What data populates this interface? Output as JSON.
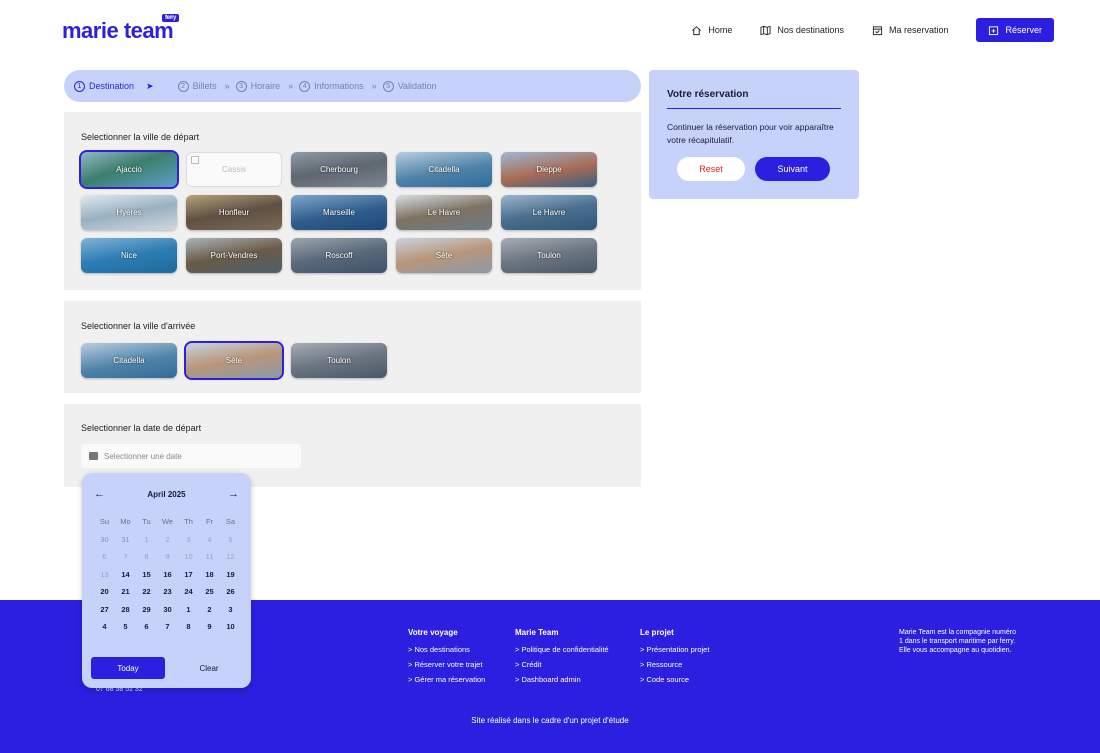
{
  "header": {
    "logo": "marie team",
    "logo_badge": "ferry",
    "nav": [
      {
        "label": "Home",
        "icon": "home-icon"
      },
      {
        "label": "Nos destinations",
        "icon": "map-icon"
      },
      {
        "label": "Ma reservation",
        "icon": "calendar-check-icon"
      }
    ],
    "cta": {
      "label": "Réserver",
      "icon": "calendar-plus-icon"
    }
  },
  "stepper": {
    "steps": [
      {
        "num": "1",
        "label": "Destination",
        "active": true
      },
      {
        "num": "2",
        "label": "Billets"
      },
      {
        "num": "3",
        "label": "Horaire"
      },
      {
        "num": "4",
        "label": "Informations"
      },
      {
        "num": "5",
        "label": "Validation"
      }
    ],
    "separator": "»"
  },
  "departure": {
    "title": "Selectionner la ville de départ",
    "cities": [
      {
        "name": "Ajaccio",
        "selected": true
      },
      {
        "name": "Cassis",
        "broken": true
      },
      {
        "name": "Cherbourg"
      },
      {
        "name": "Citadella"
      },
      {
        "name": "Dieppe"
      },
      {
        "name": "Hyères"
      },
      {
        "name": "Honfleur"
      },
      {
        "name": "Marseille"
      },
      {
        "name": "Le Havre"
      },
      {
        "name": "Le Havre"
      },
      {
        "name": "Nice"
      },
      {
        "name": "Port-Vendres"
      },
      {
        "name": "Roscoff"
      },
      {
        "name": "Sète"
      },
      {
        "name": "Toulon"
      }
    ]
  },
  "arrival": {
    "title": "Selectionner la ville d'arrivée",
    "cities": [
      {
        "name": "Citadella"
      },
      {
        "name": "Sète",
        "selected": true
      },
      {
        "name": "Toulon"
      }
    ]
  },
  "date": {
    "title": "Selectionner la date de départ",
    "placeholder": "Selectionner une date"
  },
  "summary": {
    "title": "Votre réservation",
    "text": "Continuer la réservation pour voir apparaître votre récapitulatif.",
    "reset": "Reset",
    "next": "Suivant"
  },
  "calendar": {
    "month": "April 2025",
    "prev": "←",
    "next": "→",
    "weekdays": [
      "Su",
      "Mo",
      "Tu",
      "We",
      "Th",
      "Fr",
      "Sa"
    ],
    "days": [
      {
        "d": "30",
        "s": "mut"
      },
      {
        "d": "31",
        "s": "mut"
      },
      {
        "d": "1",
        "s": "dim"
      },
      {
        "d": "2",
        "s": "dim"
      },
      {
        "d": "3",
        "s": "dim"
      },
      {
        "d": "4",
        "s": "dim"
      },
      {
        "d": "5",
        "s": "dim"
      },
      {
        "d": "6",
        "s": "dim"
      },
      {
        "d": "7",
        "s": "dim"
      },
      {
        "d": "8",
        "s": "dim"
      },
      {
        "d": "9",
        "s": "dim"
      },
      {
        "d": "10",
        "s": "dim"
      },
      {
        "d": "11",
        "s": "dim"
      },
      {
        "d": "12",
        "s": "dim"
      },
      {
        "d": "13",
        "s": "dim"
      },
      {
        "d": "14",
        "s": "on"
      },
      {
        "d": "15",
        "s": "on"
      },
      {
        "d": "16",
        "s": "on"
      },
      {
        "d": "17",
        "s": "on"
      },
      {
        "d": "18",
        "s": "on"
      },
      {
        "d": "19",
        "s": "on"
      },
      {
        "d": "20",
        "s": "on"
      },
      {
        "d": "21",
        "s": "on"
      },
      {
        "d": "22",
        "s": "on"
      },
      {
        "d": "23",
        "s": "on"
      },
      {
        "d": "24",
        "s": "on"
      },
      {
        "d": "25",
        "s": "on"
      },
      {
        "d": "26",
        "s": "on"
      },
      {
        "d": "27",
        "s": "on"
      },
      {
        "d": "28",
        "s": "on"
      },
      {
        "d": "29",
        "s": "on"
      },
      {
        "d": "30",
        "s": "on"
      },
      {
        "d": "1",
        "s": "on"
      },
      {
        "d": "2",
        "s": "on"
      },
      {
        "d": "3",
        "s": "on"
      },
      {
        "d": "4",
        "s": "on"
      },
      {
        "d": "5",
        "s": "on"
      },
      {
        "d": "6",
        "s": "on"
      },
      {
        "d": "7",
        "s": "on"
      },
      {
        "d": "8",
        "s": "on"
      },
      {
        "d": "9",
        "s": "on"
      },
      {
        "d": "10",
        "s": "on"
      }
    ],
    "today": "Today",
    "clear": "Clear"
  },
  "footer": {
    "phone": "07 68 58 52 32",
    "columns": [
      {
        "title": "Votre voyage",
        "links": [
          "> Nos destinations",
          "> Réserver votre trajet",
          "> Gérer ma réservation"
        ]
      },
      {
        "title": "Marie Team",
        "links": [
          "> Politique de confidentialité",
          "> Crédit",
          "> Dashboard admin"
        ]
      },
      {
        "title": "Le projet",
        "links": [
          "> Présentation projet",
          "> Ressource",
          "> Code source"
        ]
      }
    ],
    "about": "Marie Team est la compagnie numéro 1 dans le transport maritime par ferry. Elle vous accompagne au quotidien.",
    "bottom": "Site réalisé dans le cadre d'un projet d'étude"
  },
  "colors": {
    "brand": "#2c1fe0",
    "light": "#c7d2fb",
    "panel": "#f0f0f0",
    "reset": "#e02424"
  }
}
